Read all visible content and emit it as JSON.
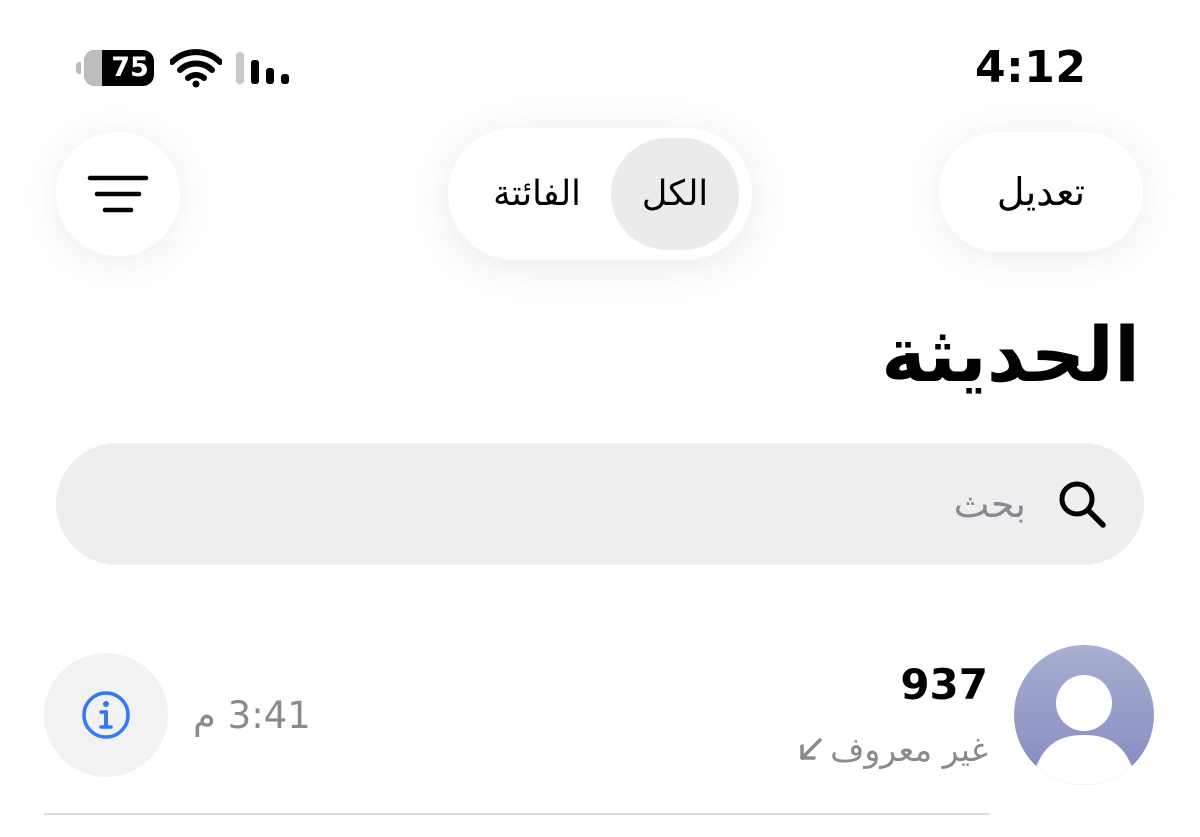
{
  "status_bar": {
    "time": "4:12",
    "battery_percent": "75",
    "battery_level": 75,
    "wifi_icon": "wifi-icon",
    "signal_icon": "cellular-signal-icon"
  },
  "toolbar": {
    "filter_icon": "filter-lines-icon",
    "segments": [
      {
        "label": "الفائتة",
        "selected": false
      },
      {
        "label": "الكل",
        "selected": true
      }
    ],
    "edit_label": "تعديل"
  },
  "page": {
    "title": "الحديثة"
  },
  "search": {
    "placeholder": "بحث",
    "icon": "search-icon"
  },
  "calls": [
    {
      "name": "937",
      "type_label": "غير معروف",
      "direction_icon": "incoming-arrow-icon",
      "time": "3:41 م",
      "info_icon": "info-icon",
      "avatar_icon": "person-avatar-icon"
    }
  ],
  "colors": {
    "accent": "#3478f6",
    "secondary_text": "#8a8a8e",
    "search_bg": "#eeeef0",
    "selected_segment_bg": "#ebebeb",
    "avatar_gradient_top": "#a7afd2",
    "avatar_gradient_bottom": "#8589bf"
  }
}
